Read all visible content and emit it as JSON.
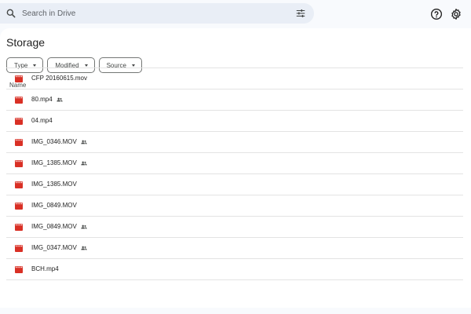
{
  "search": {
    "placeholder": "Search in Drive"
  },
  "page": {
    "title": "Storage"
  },
  "filters": [
    {
      "label": "Type"
    },
    {
      "label": "Modified"
    },
    {
      "label": "Source"
    }
  ],
  "table": {
    "column_name": "Name"
  },
  "files": [
    {
      "name": "CFP 20160615.mov",
      "shared": false
    },
    {
      "name": "80.mp4",
      "shared": true
    },
    {
      "name": "04.mp4",
      "shared": false
    },
    {
      "name": "IMG_0346.MOV",
      "shared": true
    },
    {
      "name": "IMG_1385.MOV",
      "shared": true
    },
    {
      "name": "IMG_1385.MOV",
      "shared": false
    },
    {
      "name": "IMG_0849.MOV",
      "shared": false
    },
    {
      "name": "IMG_0849.MOV",
      "shared": true
    },
    {
      "name": "IMG_0347.MOV",
      "shared": true
    },
    {
      "name": "BCH.mp4",
      "shared": false
    }
  ],
  "colors": {
    "video_icon": "#d93025",
    "icon_gray": "#444746"
  },
  "icons": {
    "search": "search-icon",
    "tune": "tune-icon",
    "help": "help-icon",
    "settings": "settings-icon",
    "video": "video-file-icon",
    "shared": "shared-people-icon"
  }
}
